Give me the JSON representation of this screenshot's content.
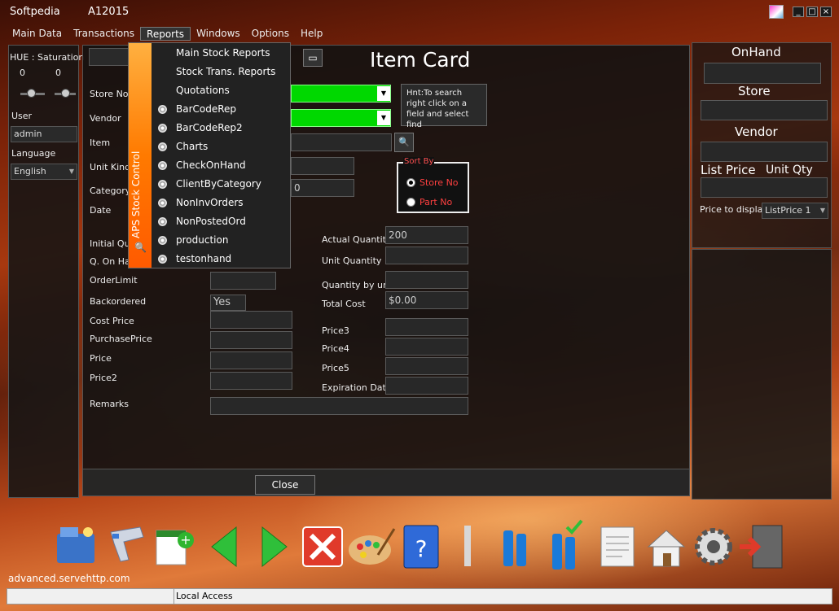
{
  "window": {
    "title": "Softpedia",
    "code": "A12015"
  },
  "menubar": [
    "Main Data",
    "Transactions",
    "Reports",
    "Windows",
    "Options",
    "Help"
  ],
  "left": {
    "hue_label": "HUE :",
    "saturation_label": "Saturation",
    "hue_value": "0",
    "saturation_value": "0",
    "user_label": "User",
    "user_value": "admin",
    "language_label": "Language",
    "language_value": "English"
  },
  "main": {
    "title": "Item Card",
    "labels": {
      "store_no": "Store No",
      "vendor": "Vendor",
      "item": "Item",
      "unit_kind": "Unit Kind",
      "category": "Category",
      "date": "Date",
      "initial_qty": "Initial Qua",
      "q_on_hand": "Q. On Han",
      "order_limit": "OrderLimit",
      "backordered": "Backordered",
      "cost_price": "Cost Price",
      "purchase_price": "PurchasePrice",
      "price": "Price",
      "price2": "Price2",
      "remarks": "Remarks",
      "actual_qty": "Actual Quantity",
      "unit_qty": "Unit Quantity",
      "qty_by_unit": "Quantity by unit",
      "total_cost": "Total Cost",
      "price3": "Price3",
      "price4": "Price4",
      "price5": "Price5",
      "expiration": "Expiration Date"
    },
    "values": {
      "category_tail": "0",
      "backordered": "Yes",
      "actual_qty": "200",
      "total_cost": "$0.00"
    },
    "hint": "Hnt:To search right click on a field and select find",
    "sort_by": {
      "title": "Sort By",
      "options": [
        "Store No",
        "Part No"
      ],
      "selected": "Store No"
    },
    "close_label": "Close"
  },
  "right": {
    "onhand": "OnHand",
    "store": "Store",
    "vendor": "Vendor",
    "list_price": "List Price",
    "unit_qty": "Unit Qty",
    "price_to_display": "Price to display",
    "price_option": "ListPrice 1"
  },
  "reports_menu": {
    "strip_label": "APS Stock Control",
    "items": [
      "Main Stock Reports",
      "Stock Trans. Reports",
      "Quotations",
      "BarCodeRep",
      "BarCodeRep2",
      "Charts",
      "CheckOnHand",
      "ClientByCategory",
      "NonInvOrders",
      "NonPostedOrd",
      "production",
      "testonhand"
    ]
  },
  "toolbar": [
    "open-folder-icon",
    "barcode-scanner-icon",
    "new-item-icon",
    "back-arrow-icon",
    "forward-arrow-icon",
    "delete-icon",
    "palette-icon",
    "help-book-icon",
    "bottles-icon",
    "bottles-check-icon",
    "document-icon",
    "home-icon",
    "settings-gear-icon",
    "exit-door-icon"
  ],
  "footer": {
    "site": "advanced.servehttp.com",
    "status": "Local Access"
  },
  "colors": {
    "accent_green": "#00d800",
    "menu_strip": "#ff7a00"
  }
}
